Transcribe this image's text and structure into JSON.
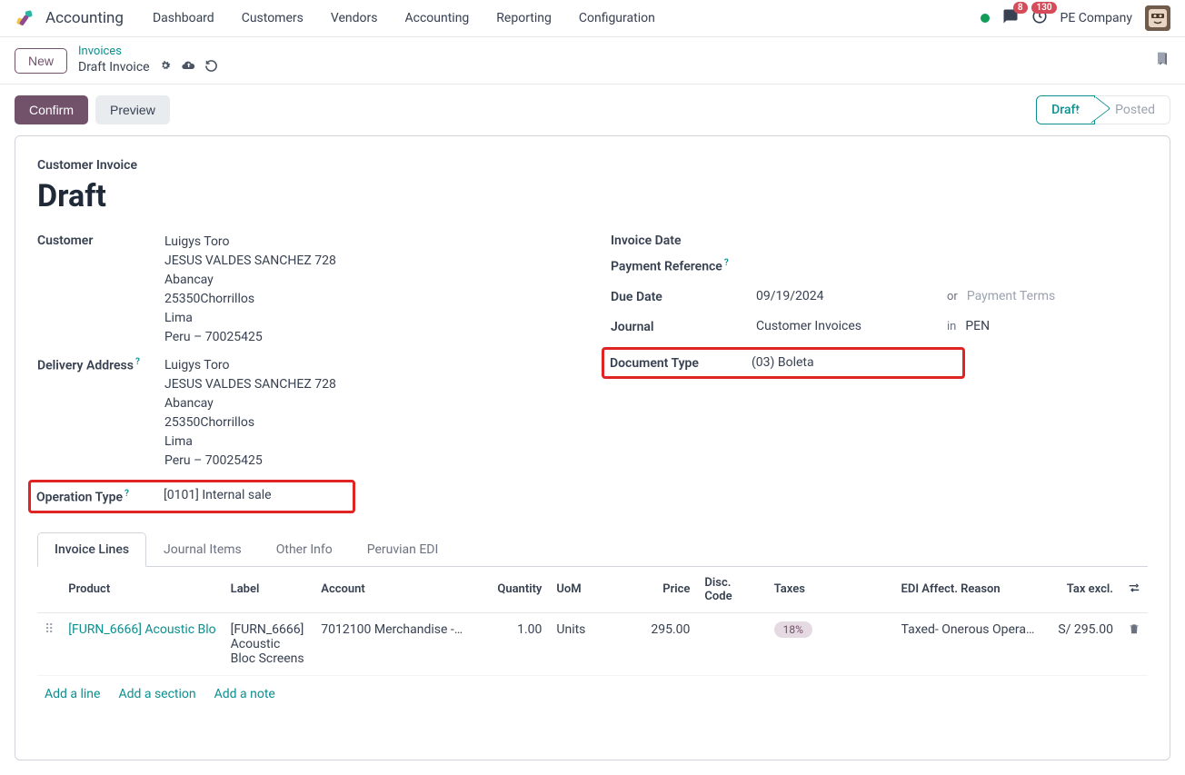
{
  "app_name": "Accounting",
  "nav": [
    "Dashboard",
    "Customers",
    "Vendors",
    "Accounting",
    "Reporting",
    "Configuration"
  ],
  "badges": {
    "messages": "8",
    "activities": "130"
  },
  "company": "PE Company",
  "btn_new": "New",
  "breadcrumb": {
    "parent": "Invoices",
    "current": "Draft Invoice"
  },
  "actions": {
    "confirm": "Confirm",
    "preview": "Preview"
  },
  "status": {
    "draft": "Draft",
    "posted": "Posted"
  },
  "doc": {
    "type_label": "Customer Invoice",
    "title": "Draft"
  },
  "left": {
    "customer_label": "Customer",
    "customer": [
      "Luigys Toro",
      "JESUS VALDES SANCHEZ 728",
      "Abancay",
      "25350Chorrillos",
      "Lima",
      "Peru – 70025425"
    ],
    "delivery_label": "Delivery Address",
    "delivery": [
      "Luigys Toro",
      "JESUS VALDES SANCHEZ 728",
      "Abancay",
      "25350Chorrillos",
      "Lima",
      "Peru – 70025425"
    ],
    "operation_label": "Operation Type",
    "operation_value": "[0101] Internal sale"
  },
  "right": {
    "invoice_date_label": "Invoice Date",
    "invoice_date_value": "",
    "payment_ref_label": "Payment Reference",
    "due_date_label": "Due Date",
    "due_date_value": "09/19/2024",
    "due_sep": "or",
    "payment_terms_placeholder": "Payment Terms",
    "journal_label": "Journal",
    "journal_value": "Customer Invoices",
    "journal_sep": "in",
    "currency": "PEN",
    "doc_type_label": "Document Type",
    "doc_type_value": "(03) Boleta"
  },
  "tabs": [
    "Invoice Lines",
    "Journal Items",
    "Other Info",
    "Peruvian EDI"
  ],
  "table": {
    "headers": {
      "product": "Product",
      "label": "Label",
      "account": "Account",
      "quantity": "Quantity",
      "uom": "UoM",
      "price": "Price",
      "disc": "Disc. Code",
      "taxes": "Taxes",
      "edi": "EDI Affect. Reason",
      "tax_excl": "Tax excl."
    },
    "rows": [
      {
        "product": "[FURN_6666] Acoustic Blo",
        "label": "[FURN_6666] Acoustic Bloc Screens",
        "account": "7012100 Merchandise -…",
        "quantity": "1.00",
        "uom": "Units",
        "price": "295.00",
        "disc": "",
        "taxes": "18%",
        "edi": "Taxed- Onerous Opera…",
        "tax_excl": "S/ 295.00"
      }
    ]
  },
  "add": {
    "line": "Add a line",
    "section": "Add a section",
    "note": "Add a note"
  },
  "help": "?"
}
